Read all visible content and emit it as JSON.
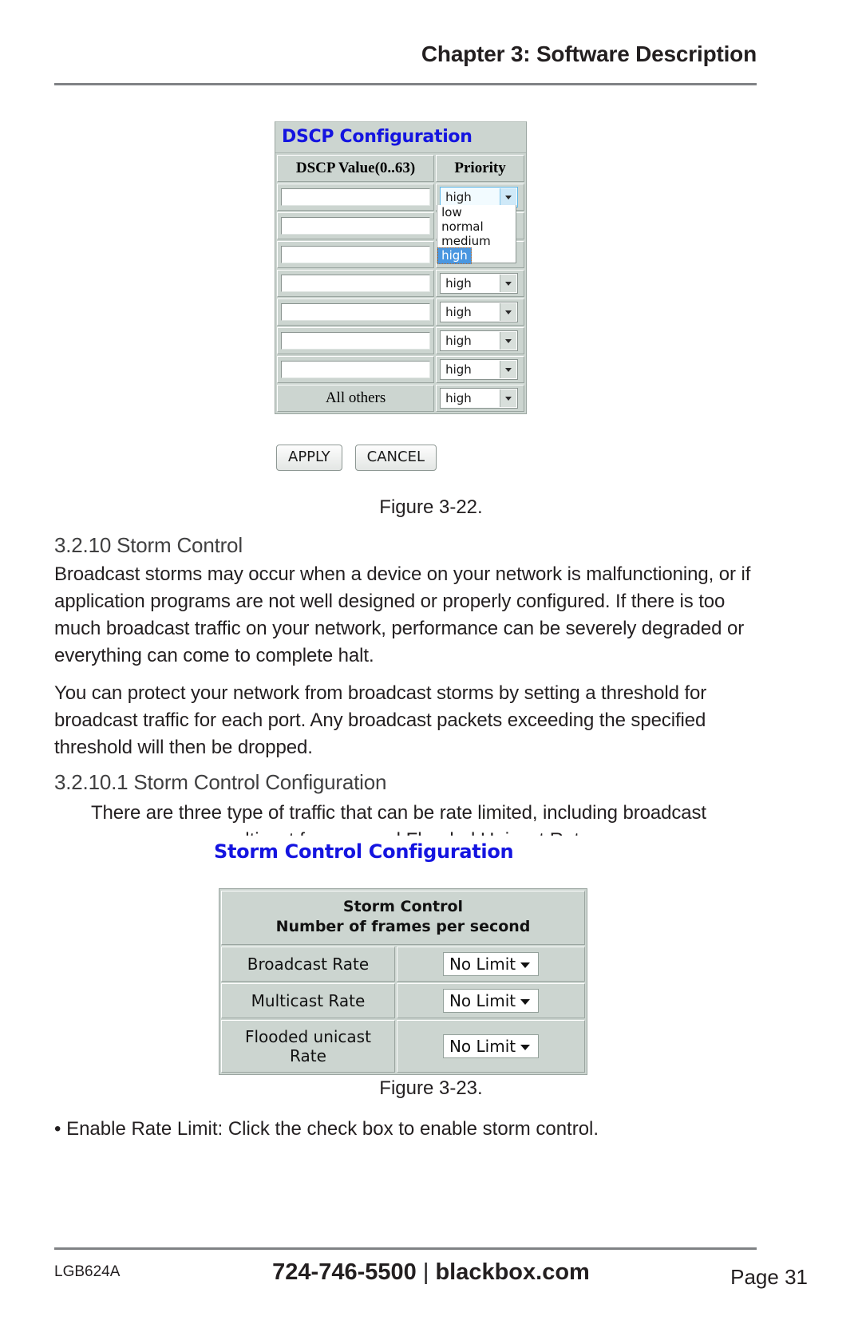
{
  "header": {
    "chapter_title": "Chapter 3: Software Description"
  },
  "figure_dscp": {
    "panel_title": "DSCP Configuration",
    "columns": [
      "DSCP Value(0..63)",
      "Priority"
    ],
    "rows": [
      {
        "value": "",
        "priority": "high",
        "open": true
      },
      {
        "value": "",
        "priority": "high",
        "open": false
      },
      {
        "value": "",
        "priority": "high",
        "open": false
      },
      {
        "value": "",
        "priority": "high",
        "open": false
      },
      {
        "value": "",
        "priority": "high",
        "open": false
      },
      {
        "value": "",
        "priority": "high",
        "open": false
      },
      {
        "value": "",
        "priority": "high",
        "open": false
      }
    ],
    "all_others_label": "All others",
    "all_others_priority": "high",
    "dropdown_options": [
      "low",
      "normal",
      "medium",
      "high"
    ],
    "dropdown_selected": "high",
    "buttons": {
      "apply": "APPLY",
      "cancel": "CANCEL"
    },
    "caption": "Figure 3-22."
  },
  "section_storm_control": {
    "heading": "3.2.10 Storm Control",
    "paragraph_1": "Broadcast storms may occur when a device on your network is malfunctioning, or if application programs are not well designed or properly configured. If there is too much broadcast traffic on your network, performance can be severely degraded or everything can come to complete halt.",
    "paragraph_2": "You can protect your network from broadcast storms by setting a threshold for broadcast traffic for each port. Any broadcast packets exceeding the specified threshold will then be dropped."
  },
  "section_storm_config": {
    "heading": "3.2.10.1 Storm Control Configuration",
    "paragraph_1": "There are three type of traffic that can be rate limited, including broadcast",
    "paragraph_1_clipped": "multicast frames, and Flooded Unicast Rate."
  },
  "figure_storm": {
    "panel_title": "Storm Control Configuration",
    "table_header_line1": "Storm Control",
    "table_header_line2": "Number of frames per second",
    "rows": [
      {
        "label": "Broadcast Rate",
        "value": "No Limit"
      },
      {
        "label": "Multicast Rate",
        "value": "No Limit"
      },
      {
        "label": "Flooded unicast Rate",
        "value": "No Limit"
      }
    ],
    "caption": "Figure 3-23."
  },
  "bullets": {
    "enable_rate_limit": "• Enable Rate Limit: Click the check box to enable storm control."
  },
  "footer": {
    "model": "LGB624A",
    "phone": "724-746-5500",
    "separator": "|",
    "website": "blackbox.com",
    "page": "Page 31"
  },
  "colors": {
    "ui_title_blue": "#1414e0",
    "panel_bg": "#ccd5d0",
    "selection_blue": "#4a97e0",
    "rule_gray": "#808285"
  }
}
